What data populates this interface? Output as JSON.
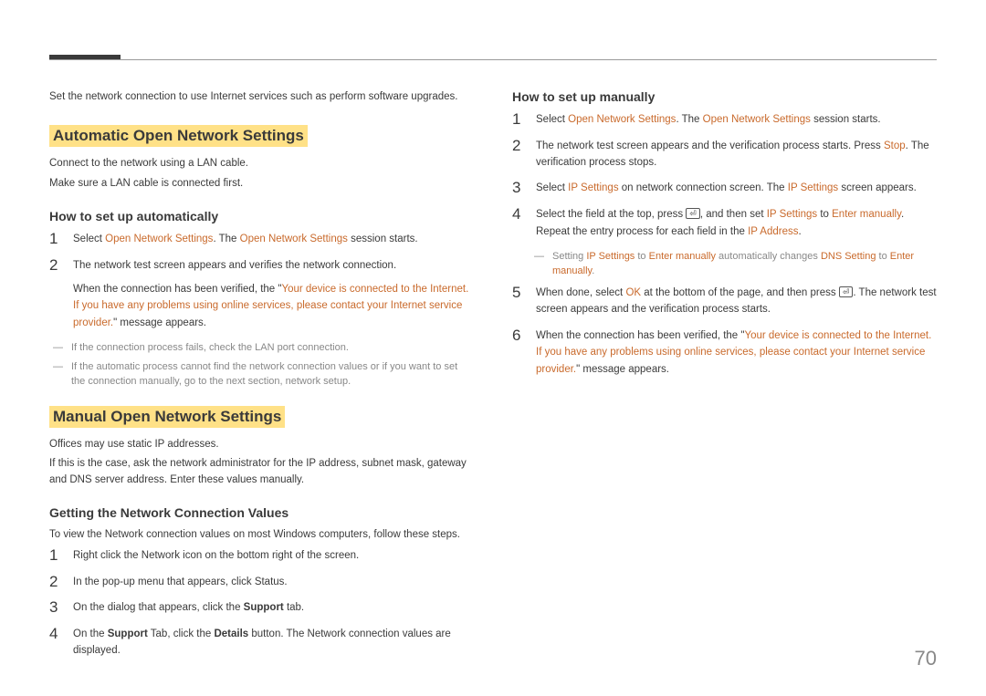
{
  "page_number": "70",
  "left": {
    "intro": "Set the network connection to use Internet services such as perform software upgrades.",
    "auto": {
      "title": "Automatic Open Network Settings",
      "p1": "Connect to the network using a LAN cable.",
      "p2": "Make sure a LAN cable is connected first.",
      "heading": "How to set up automatically",
      "steps": {
        "s1_a": "Select ",
        "s1_b": "Open Network Settings",
        "s1_c": ". The ",
        "s1_d": "Open Network Settings",
        "s1_e": " session starts.",
        "s2": "The network test screen appears and verifies the network connection.",
        "s2b_a": "When the connection has been verified, the \"",
        "s2b_b": "Your device is connected to the Internet. If you have any problems using online services, please contact your Internet service provider.",
        "s2b_c": "\" message appears."
      },
      "note1": "If the connection process fails, check the LAN port connection.",
      "note2": "If the automatic process cannot find the network connection values or if you want to set the connection manually, go to the next section, network setup."
    },
    "manual": {
      "title": "Manual Open Network Settings",
      "p1": "Offices may use static IP addresses.",
      "p2": "If this is the case, ask the network administrator for the IP address, subnet mask, gateway and DNS server address. Enter these values manually.",
      "getvals": {
        "heading": "Getting the Network Connection Values",
        "intro": "To view the Network connection values on most Windows computers, follow these steps.",
        "s1": "Right click the Network icon on the bottom right of the screen.",
        "s2": "In the pop-up menu that appears, click Status.",
        "s3_a": "On the dialog that appears, click the ",
        "s3_b": "Support",
        "s3_c": " tab.",
        "s4_a": "On the ",
        "s4_b": "Support",
        "s4_c": " Tab, click the ",
        "s4_d": "Details",
        "s4_e": " button. The Network connection values are displayed."
      }
    }
  },
  "right": {
    "heading": "How to set up manually",
    "s1_a": "Select ",
    "s1_b": "Open Network Settings",
    "s1_c": ". The ",
    "s1_d": "Open Network Settings",
    "s1_e": " session starts.",
    "s2_a": "The network test screen appears and the verification process starts. Press ",
    "s2_b": "Stop",
    "s2_c": ". The verification process stops.",
    "s3_a": "Select ",
    "s3_b": "IP Settings",
    "s3_c": " on network connection screen. The ",
    "s3_d": "IP Settings",
    "s3_e": " screen appears.",
    "s4_a": "Select the field at the top, press ",
    "s4_b": ", and then set ",
    "s4_c": "IP Settings",
    "s4_d": " to ",
    "s4_e": "Enter manually",
    "s4_f": ". Repeat the entry process for each field in the ",
    "s4_g": "IP Address",
    "s4_h": ".",
    "note_a": "Setting ",
    "note_b": "IP Settings",
    "note_c": " to ",
    "note_d": "Enter manually",
    "note_e": " automatically changes ",
    "note_f": "DNS Setting",
    "note_g": " to ",
    "note_h": "Enter manually",
    "note_i": ".",
    "s5_a": "When done, select ",
    "s5_b": "OK",
    "s5_c": " at the bottom of the page, and then press ",
    "s5_d": ". The network test screen appears and the verification process starts.",
    "s6_a": "When the connection has been verified, the \"",
    "s6_b": "Your device is connected to the Internet. If you have any problems using online services, please contact your Internet service provider.",
    "s6_c": "\" message appears."
  }
}
